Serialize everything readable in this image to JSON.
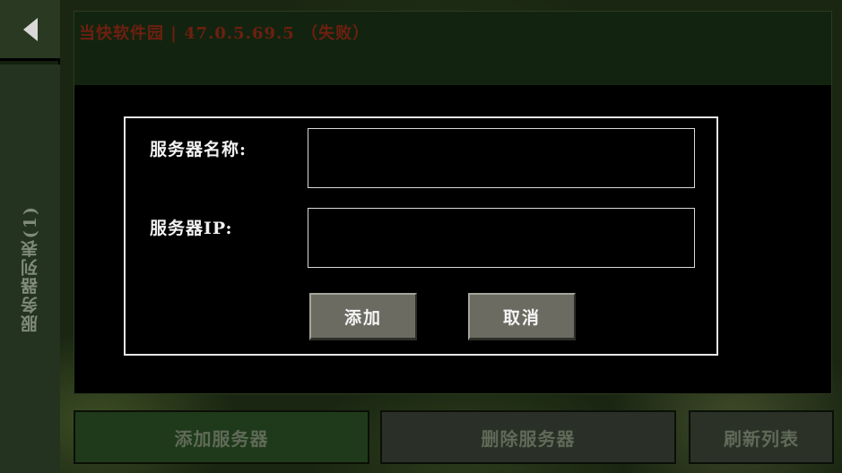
{
  "sidebar": {
    "server_list_tab_label": "服务器列表(1)"
  },
  "server_list": {
    "entries": [
      {
        "title": "当快软件园 | 47.0.5.69.5 （失败）"
      }
    ]
  },
  "bottom_bar": {
    "add_server_label": "添加服务器",
    "delete_server_label": "删除服务器",
    "refresh_list_label": "刷新列表"
  },
  "dialog": {
    "name_label": "服务器名称:",
    "ip_label": "服务器IP:",
    "name_value": "",
    "ip_value": "",
    "add_label": "添加",
    "cancel_label": "取消"
  },
  "icons": {
    "back": "back-arrow-icon"
  },
  "colors": {
    "dialog_border": "#e8e8e8",
    "button_gray": "#6b6b62",
    "status_fail_text": "#6e1f10",
    "add_server_bg": "#1f3a1a"
  }
}
